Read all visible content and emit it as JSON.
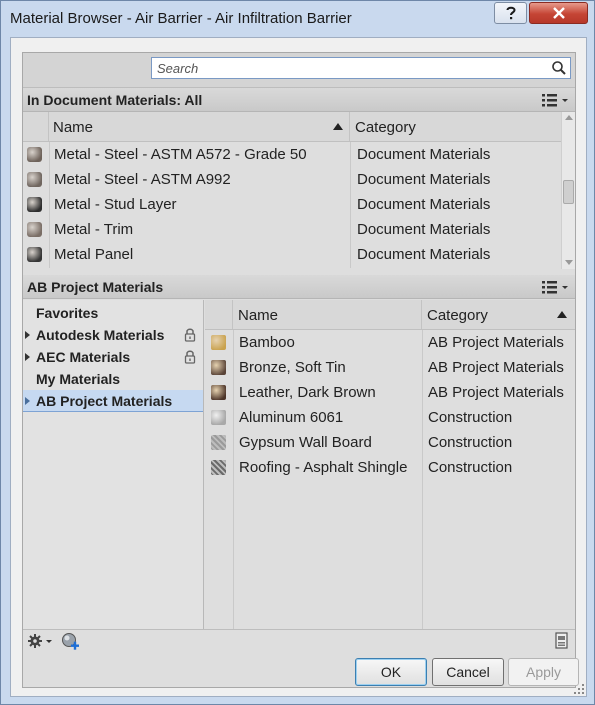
{
  "window": {
    "title": "Material Browser - Air Barrier - Air Infiltration Barrier"
  },
  "search": {
    "placeholder": "Search"
  },
  "doc_section": {
    "header": "In Document Materials: All",
    "columns": {
      "name": "Name",
      "category": "Category"
    },
    "rows": [
      {
        "name": "Metal - Steel - ASTM A572 - Grade 50",
        "category": "Document Materials",
        "swatch": "#6e625a"
      },
      {
        "name": "Metal - Steel - ASTM A992",
        "category": "Document Materials",
        "swatch": "#70665f"
      },
      {
        "name": "Metal - Stud Layer",
        "category": "Document Materials",
        "swatch": "#2e2e2e"
      },
      {
        "name": "Metal - Trim",
        "category": "Document Materials",
        "swatch": "#7a6e66"
      },
      {
        "name": "Metal Panel",
        "category": "Document Materials",
        "swatch": "#353535"
      }
    ]
  },
  "library_section": {
    "header": "AB Project Materials",
    "tree": [
      {
        "label": "Favorites",
        "expandable": false,
        "locked": false,
        "selected": false
      },
      {
        "label": "Autodesk Materials",
        "expandable": true,
        "locked": true,
        "selected": false
      },
      {
        "label": "AEC Materials",
        "expandable": true,
        "locked": true,
        "selected": false
      },
      {
        "label": "My Materials",
        "expandable": false,
        "locked": false,
        "selected": false
      },
      {
        "label": "AB Project Materials",
        "expandable": true,
        "locked": false,
        "selected": true
      }
    ],
    "columns": {
      "name": "Name",
      "category": "Category"
    },
    "rows": [
      {
        "name": "Bamboo",
        "category": "AB Project Materials",
        "swatch": "#c9a24e"
      },
      {
        "name": "Bronze, Soft Tin",
        "category": "AB Project Materials",
        "swatch": "#5a4438"
      },
      {
        "name": "Leather, Dark Brown",
        "category": "AB Project Materials",
        "swatch": "#4c3428"
      },
      {
        "name": "Aluminum 6061",
        "category": "Construction",
        "swatch": "#a9a9a9"
      },
      {
        "name": "Gypsum Wall Board",
        "category": "Construction",
        "swatch": "#9a9a9a"
      },
      {
        "name": "Roofing - Asphalt Shingle",
        "category": "Construction",
        "swatch": "#6a6a6a"
      }
    ]
  },
  "buttons": {
    "ok": "OK",
    "cancel": "Cancel",
    "apply": "Apply"
  }
}
